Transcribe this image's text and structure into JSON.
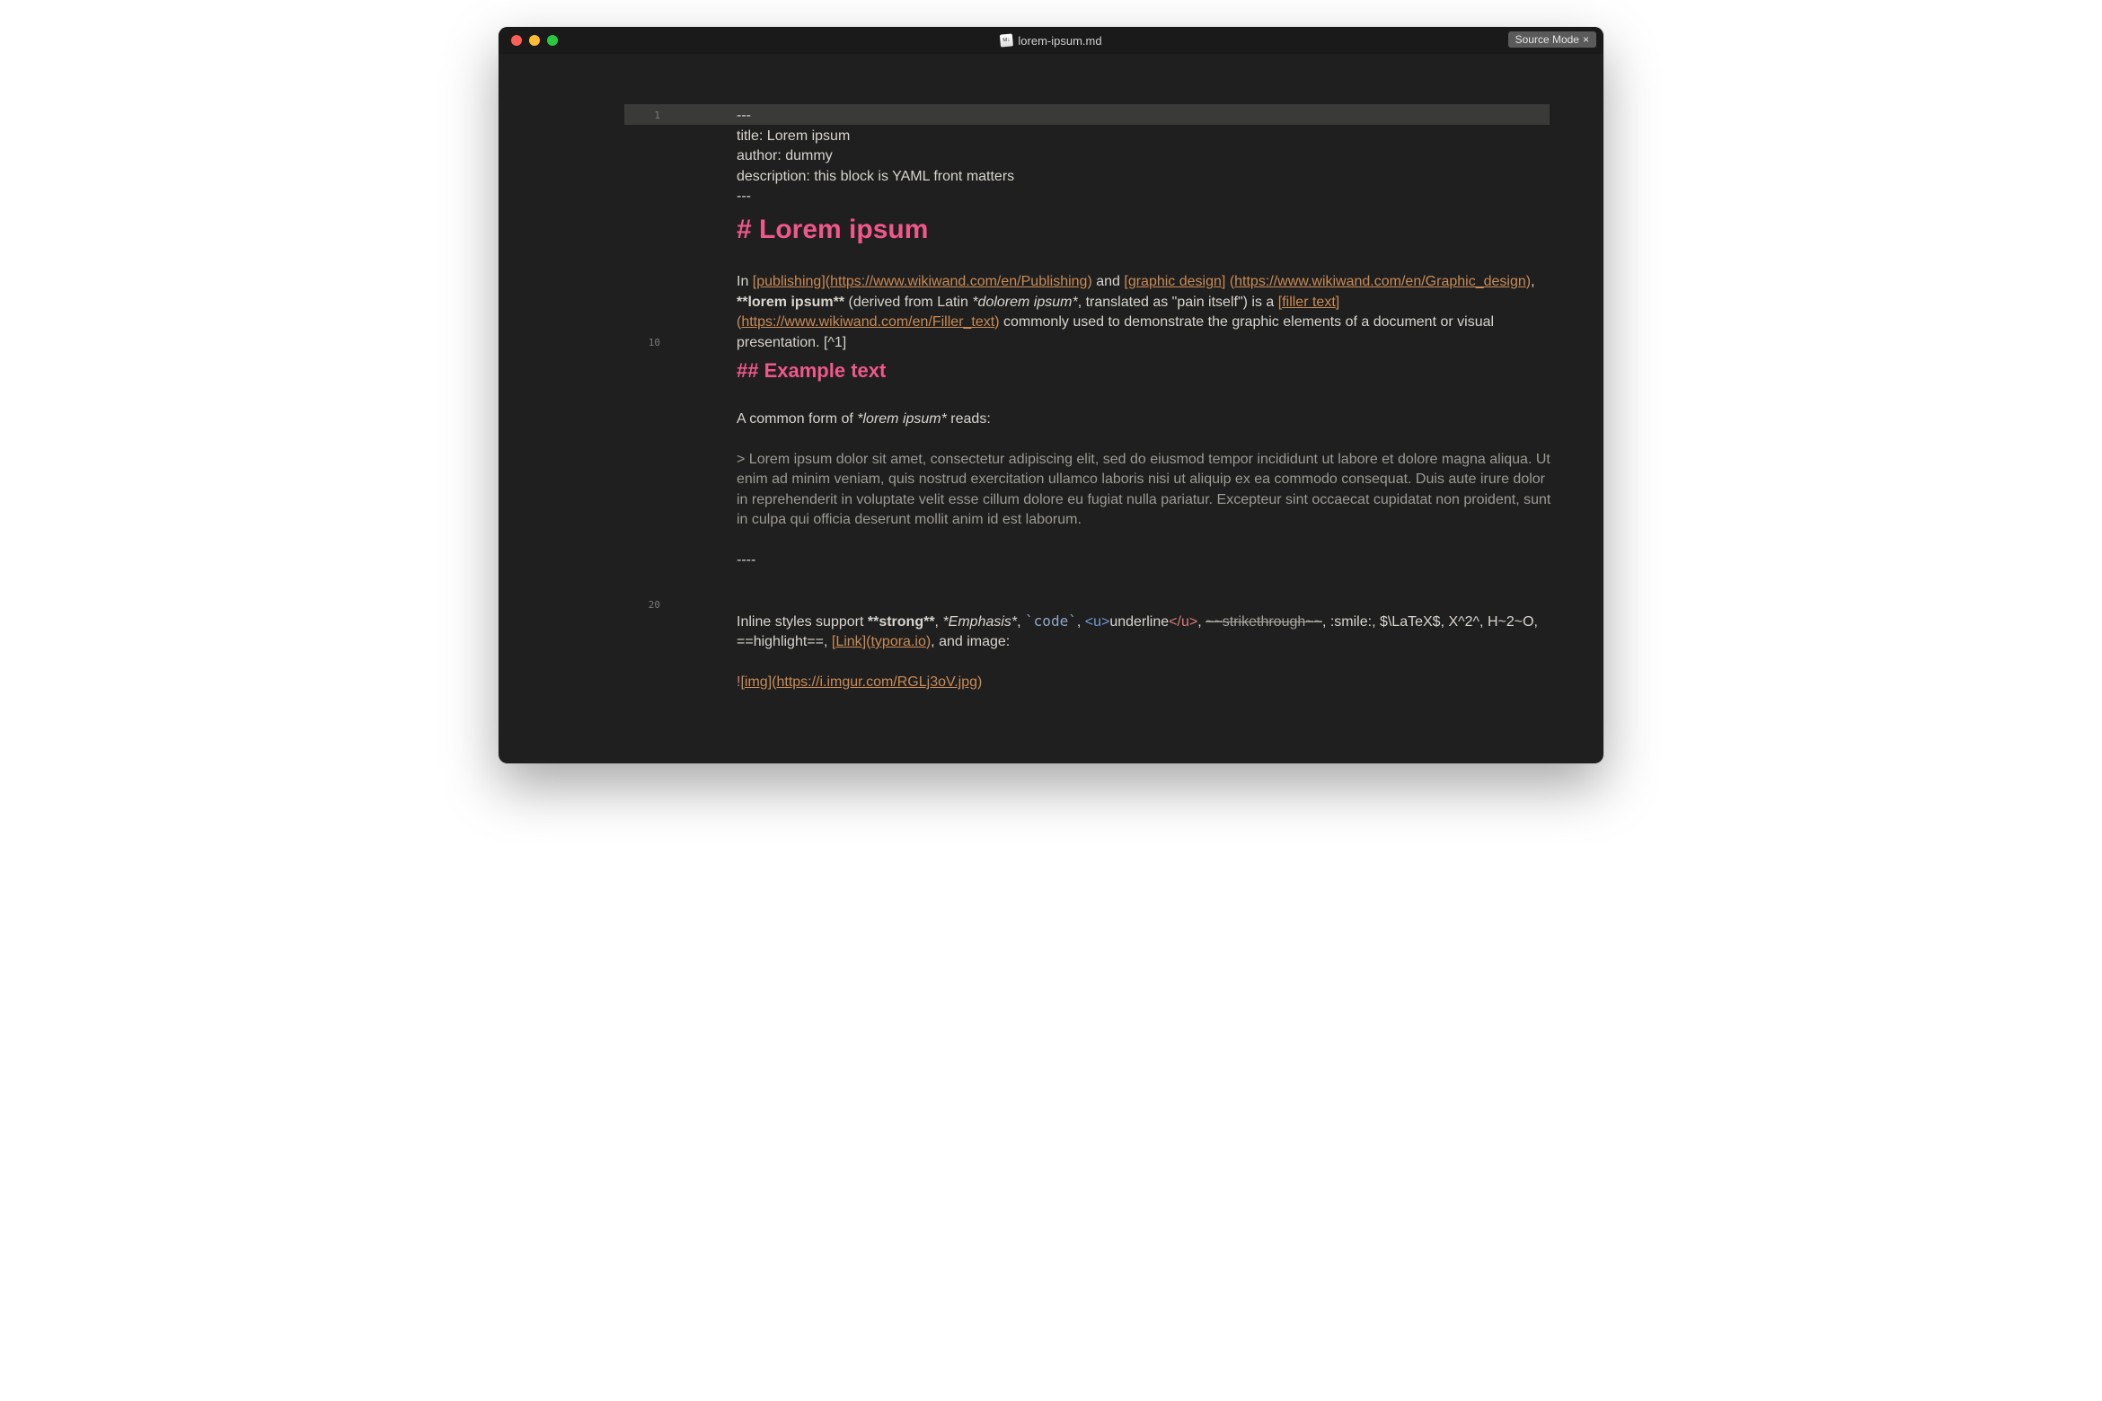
{
  "window": {
    "filename": "lorem-ipsum.md",
    "mode_label": "Source Mode",
    "mode_close": "×"
  },
  "gutter": {
    "n1": "1",
    "n10": "10",
    "n20": "20"
  },
  "front": {
    "open": "---",
    "title": "title: Lorem ipsum",
    "author": "author: dummy",
    "desc": "description: this block is YAML front matters",
    "close": "---"
  },
  "h1": "# Lorem ipsum",
  "p1": {
    "in_": "In ",
    "lb1": "[",
    "lt1": "publishing",
    "rb1": "]",
    "lp1": "(",
    "url1": "https://www.wikiwand.com/en/Publishing",
    "rp1": ")",
    "and_": " and ",
    "lb2": "[",
    "lt2": "graphic design",
    "rb2": "]",
    "lp2": "(",
    "url2": "https://www.wikiwand.com/en/Graphic_design",
    "rp2": ")",
    "comma1": ", ",
    "bold_li": "**lorem ipsum**",
    "derived": " (derived from Latin ",
    "ital_di": "*dolorem ipsum*",
    "trans": ", translated as \"pain itself\") is a ",
    "lb3": "[",
    "lt3": "filler text",
    "rb3": "]",
    "lp3": "(",
    "url3": "https://www.wikiwand.com/en/Filler_text",
    "rp3": ")",
    "tail": " commonly used to demonstrate the graphic elements of a document or visual presentation. [^1]"
  },
  "h2": "## Example text",
  "p2a": "A common form of ",
  "p2b": "*lorem ipsum*",
  "p2c": " reads:",
  "bq_prefix": ">  ",
  "bq": "Lorem ipsum dolor sit amet, consectetur adipiscing elit, sed do eiusmod tempor incididunt ut labore et dolore magna aliqua. Ut enim ad minim veniam, quis nostrud exercitation ullamco laboris nisi ut aliquip ex ea commodo consequat. Duis aute irure dolor in reprehenderit in voluptate velit esse cillum dolore eu fugiat nulla pariatur. Excepteur sint occaecat cupidatat non proident, sunt in culpa qui officia deserunt mollit anim id est laborum.",
  "hr": "----",
  "inline": {
    "pre": "Inline styles support ",
    "strong": "**strong**",
    "c1": ", ",
    "emph": "*Emphasis*",
    "c2": ", ",
    "tick1": "`",
    "code": "code",
    "tick2": "`",
    "c3": ", ",
    "uo": "<u>",
    "ut": "underline",
    "uc": "</u>",
    "c4": ", ",
    "strike": "~~strikethrough~~",
    "c5": ", :smile:, $\\LaTeX$, X^2^, H~2~O, ==highlight==, ",
    "lb": "[",
    "lt": "Link",
    "rb": "]",
    "lp": "(",
    "lurl": "typora.io",
    "rp": ")",
    "tail": ", and image:"
  },
  "img": {
    "bang": "!",
    "lb": "[",
    "alt": "img",
    "rb": "]",
    "lp": "(",
    "url": "https://i.imgur.com/RGLj3oV.jpg",
    "rp": ")"
  }
}
